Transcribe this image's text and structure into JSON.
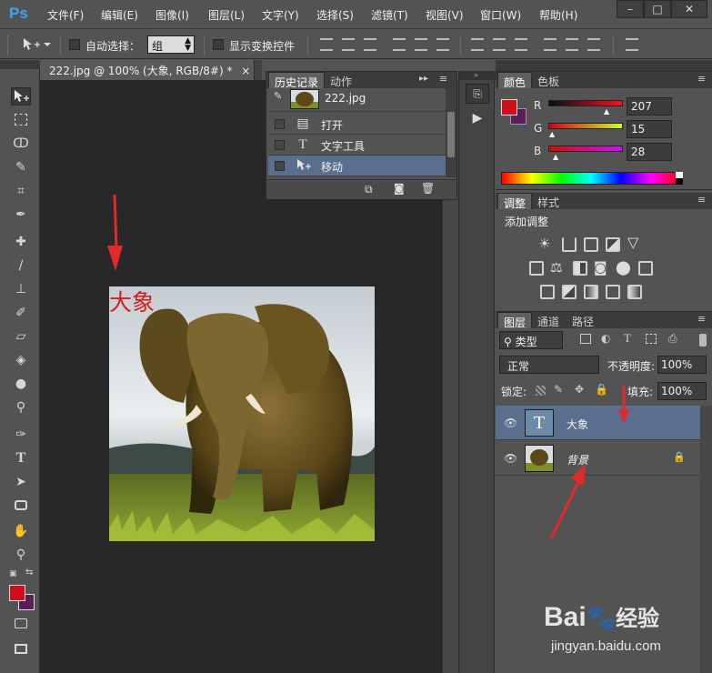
{
  "app": {
    "logo": "Ps",
    "menu": [
      "文件(F)",
      "编辑(E)",
      "图像(I)",
      "图层(L)",
      "文字(Y)",
      "选择(S)",
      "滤镜(T)",
      "视图(V)",
      "窗口(W)",
      "帮助(H)"
    ],
    "window_controls": [
      "–",
      "□",
      "✕"
    ]
  },
  "options_bar": {
    "auto_select_label": "自动选择：",
    "auto_select_value": "组",
    "show_transform_label": "显示变换控件"
  },
  "document": {
    "tab_title": "222.jpg @ 100% (大象, RGB/8#) *",
    "tab_close": "×",
    "overlay_text": "大象"
  },
  "history_panel": {
    "tabs": [
      "历史记录",
      "动作"
    ],
    "snapshot_label": "222.jpg",
    "items": [
      {
        "icon": "document-icon",
        "label": "打开"
      },
      {
        "icon": "type-icon",
        "label": "文字工具"
      },
      {
        "icon": "move-icon",
        "label": "移动"
      }
    ]
  },
  "color_panel": {
    "tabs": [
      "颜色",
      "色板"
    ],
    "channels": [
      {
        "label": "R",
        "value": "207"
      },
      {
        "label": "G",
        "value": "15"
      },
      {
        "label": "B",
        "value": "28"
      }
    ],
    "foreground": "#cf0f1c",
    "background": "#5a1f5a"
  },
  "adjust_panel": {
    "tabs": [
      "调整",
      "样式"
    ],
    "heading": "添加调整"
  },
  "layers_panel": {
    "tabs": [
      "图层",
      "通道",
      "路径"
    ],
    "filter_label": "类型",
    "blend_mode": "正常",
    "opacity_label": "不透明度:",
    "opacity_value": "100%",
    "lock_label": "锁定:",
    "fill_label": "填充:",
    "fill_value": "100%",
    "layers": [
      {
        "name": "大象",
        "type": "text",
        "selected": true
      },
      {
        "name": "背景",
        "type": "image",
        "locked": true
      }
    ]
  },
  "watermark": {
    "brand": "Bai",
    "brand2": "经验",
    "url": "jingyan.baidu.com"
  }
}
